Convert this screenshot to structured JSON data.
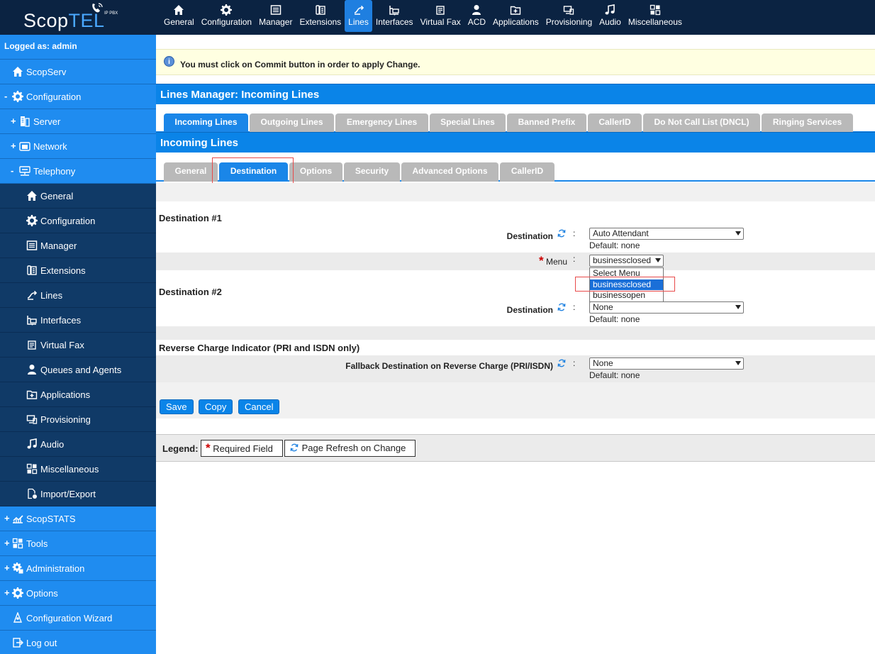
{
  "logo": {
    "brand_a": "Scop",
    "brand_b": "TEL",
    "tag": "IP PBX"
  },
  "topnav": [
    {
      "label": "General",
      "icon": "home-icon"
    },
    {
      "label": "Configuration",
      "icon": "gear-icon"
    },
    {
      "label": "Manager",
      "icon": "manager-icon"
    },
    {
      "label": "Extensions",
      "icon": "phone-icon"
    },
    {
      "label": "Lines",
      "icon": "lines-icon",
      "active": true
    },
    {
      "label": "Interfaces",
      "icon": "interfaces-icon"
    },
    {
      "label": "Virtual Fax",
      "icon": "fax-icon"
    },
    {
      "label": "ACD",
      "icon": "person-icon"
    },
    {
      "label": "Applications",
      "icon": "applications-icon"
    },
    {
      "label": "Provisioning",
      "icon": "provisioning-icon"
    },
    {
      "label": "Audio",
      "icon": "music-icon"
    },
    {
      "label": "Miscellaneous",
      "icon": "misc-icon"
    }
  ],
  "sidebar": {
    "login": "Logged as: admin",
    "items": [
      {
        "label": "ScopServ",
        "pm": "",
        "icon": "home-icon"
      },
      {
        "label": "Configuration",
        "pm": "-",
        "icon": "gear-icon"
      },
      {
        "label": "Server",
        "pm": "+",
        "icon": "server-icon"
      },
      {
        "label": "Network",
        "pm": "+",
        "icon": "network-icon"
      },
      {
        "label": "Telephony",
        "pm": "-",
        "icon": "telephony-icon"
      },
      {
        "label": "General",
        "pm": "",
        "icon": "home-icon"
      },
      {
        "label": "Configuration",
        "pm": "",
        "icon": "gear-icon"
      },
      {
        "label": "Manager",
        "pm": "",
        "icon": "manager-icon"
      },
      {
        "label": "Extensions",
        "pm": "",
        "icon": "phone-icon"
      },
      {
        "label": "Lines",
        "pm": "",
        "icon": "lines-icon"
      },
      {
        "label": "Interfaces",
        "pm": "",
        "icon": "interfaces-icon"
      },
      {
        "label": "Virtual Fax",
        "pm": "",
        "icon": "fax-icon"
      },
      {
        "label": "Queues and Agents",
        "pm": "",
        "icon": "person-icon"
      },
      {
        "label": "Applications",
        "pm": "",
        "icon": "applications-icon"
      },
      {
        "label": "Provisioning",
        "pm": "",
        "icon": "provisioning-icon"
      },
      {
        "label": "Audio",
        "pm": "",
        "icon": "music-icon"
      },
      {
        "label": "Miscellaneous",
        "pm": "",
        "icon": "misc-icon"
      },
      {
        "label": "Import/Export",
        "pm": "",
        "icon": "import-export-icon"
      },
      {
        "label": "ScopSTATS",
        "pm": "+",
        "icon": "stats-icon"
      },
      {
        "label": "Tools",
        "pm": "+",
        "icon": "tools-icon"
      },
      {
        "label": "Administration",
        "pm": "+",
        "icon": "admin-gear-icon"
      },
      {
        "label": "Options",
        "pm": "+",
        "icon": "gear-icon"
      },
      {
        "label": "Configuration Wizard",
        "pm": "",
        "icon": "wizard-icon"
      },
      {
        "label": "Log out",
        "pm": "",
        "icon": "logout-icon"
      }
    ]
  },
  "notice": "You must click on Commit button in order to apply Change.",
  "header": {
    "title": "Lines Manager:  Incoming Lines"
  },
  "tabs": [
    "Incoming Lines",
    "Outgoing Lines",
    "Emergency Lines",
    "Special Lines",
    "Banned Prefix",
    "CallerID",
    "Do Not Call List (DNCL)",
    "Ringing Services"
  ],
  "section": {
    "title": "Incoming Lines"
  },
  "subtabs": [
    "General",
    "Destination",
    "Options",
    "Security",
    "Advanced Options",
    "CallerID"
  ],
  "form": {
    "dest1": {
      "title": "Destination #1",
      "label": "Destination",
      "value": "Auto Attendant",
      "default": "Default: none"
    },
    "menu": {
      "label": "Menu",
      "required": "*",
      "value": "businessclosed",
      "options": [
        "Select Menu",
        "businessclosed",
        "businessopen"
      ]
    },
    "dest2": {
      "title": "Destination #2",
      "label": "Destination",
      "value": "None",
      "default": "Default: none"
    },
    "reverse": {
      "title": "Reverse Charge Indicator (PRI and ISDN only)",
      "label": "Fallback Destination on Reverse Charge (PRI/ISDN)",
      "value": "None",
      "default": "Default: none"
    },
    "colon": ":"
  },
  "buttons": {
    "save": "Save",
    "copy": "Copy",
    "cancel": "Cancel"
  },
  "legend": {
    "title": "Legend:",
    "required": "Required Field",
    "required_mark": "*",
    "refresh": "Page Refresh on Change"
  }
}
